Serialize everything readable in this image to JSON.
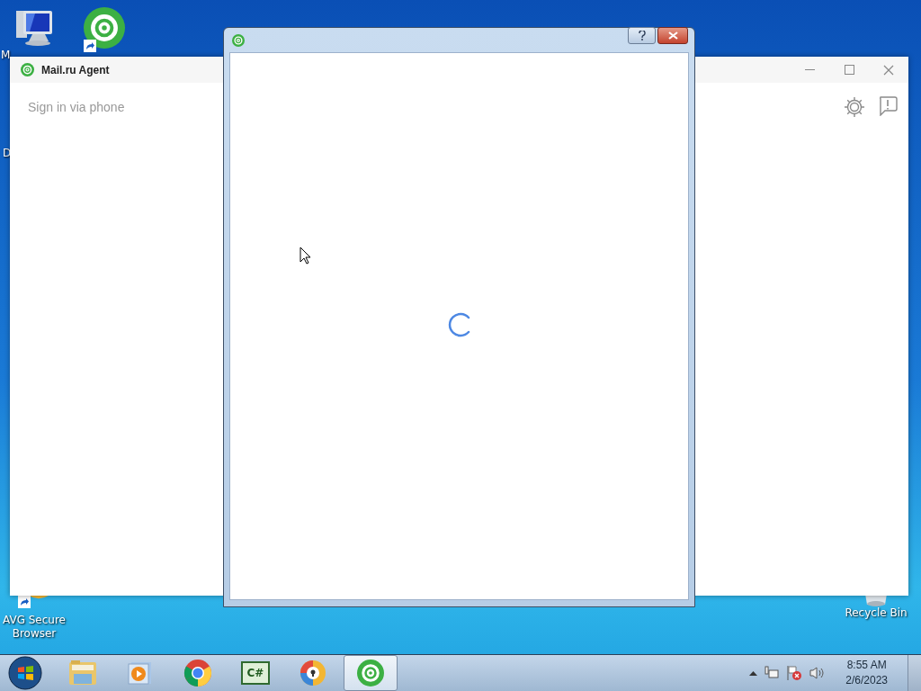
{
  "desktop": {
    "icons": [
      {
        "kind": "computer",
        "label": "M"
      },
      {
        "kind": "agent"
      },
      {
        "kind": "browser",
        "label": "AVG Secure Browser"
      },
      {
        "kind": "bin",
        "label": "Recycle Bin"
      }
    ],
    "edge_fragments": [
      "D"
    ]
  },
  "main_window": {
    "title": "Mail.ru Agent",
    "link": "Sign in via phone"
  },
  "dialog": {
    "loading": true
  },
  "taskbar": {
    "apps": [
      {
        "kind": "folder",
        "selected": false
      },
      {
        "kind": "player",
        "selected": false
      },
      {
        "kind": "chrome",
        "selected": false
      },
      {
        "kind": "csharp",
        "label": "C#",
        "selected": false
      },
      {
        "kind": "avg",
        "selected": false
      },
      {
        "kind": "agent",
        "selected": true
      }
    ],
    "clock": {
      "time": "8:55 AM",
      "date": "2/6/2023"
    }
  }
}
